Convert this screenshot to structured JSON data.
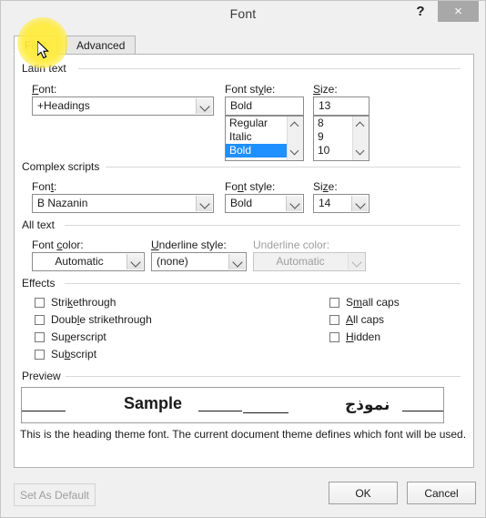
{
  "window": {
    "title": "Font",
    "help_label": "?",
    "close_label": "×"
  },
  "tabs": [
    {
      "label": "Font",
      "active": true
    },
    {
      "label": "Advanced",
      "active": false
    }
  ],
  "groups": {
    "latin_text": "Latin text",
    "complex_scripts": "Complex scripts",
    "all_text": "All text",
    "effects": "Effects",
    "preview": "Preview"
  },
  "latin_text": {
    "font_label": "Font:",
    "font_value": "+Headings",
    "style_label": "Font style:",
    "style_value": "Bold",
    "style_options": [
      "Regular",
      "Italic",
      "Bold"
    ],
    "style_selected": "Bold",
    "size_label": "Size:",
    "size_value": "13",
    "size_options": [
      "8",
      "9",
      "10"
    ],
    "size_selected": ""
  },
  "complex_scripts": {
    "font_label": "Font:",
    "font_value": "B Nazanin",
    "style_label": "Font style:",
    "style_value": "Bold",
    "size_label": "Size:",
    "size_value": "14"
  },
  "all_text": {
    "font_color_label": "Font color:",
    "font_color_value": "Automatic",
    "underline_style_label": "Underline style:",
    "underline_style_value": "(none)",
    "underline_color_label": "Underline color:",
    "underline_color_value": "Automatic",
    "underline_color_disabled": true
  },
  "effects": {
    "left": [
      {
        "label": "Strikethrough",
        "checked": false
      },
      {
        "label": "Double strikethrough",
        "checked": false
      },
      {
        "label": "Superscript",
        "checked": false
      },
      {
        "label": "Subscript",
        "checked": false
      }
    ],
    "right": [
      {
        "label": "Small caps",
        "checked": false
      },
      {
        "label": "All caps",
        "checked": false
      },
      {
        "label": "Hidden",
        "checked": false
      }
    ]
  },
  "preview": {
    "latin_sample": "Sample",
    "complex_sample": "نموذج",
    "note": "This is the heading theme font. The current document theme defines which font will be used."
  },
  "footer": {
    "set_as_default": "Set As Default",
    "set_as_default_disabled": true,
    "ok": "OK",
    "cancel": "Cancel"
  },
  "colors": {
    "dialog_bg": "#f0f0f0",
    "panel_bg": "#ffffff",
    "selection_blue": "#1e90ff",
    "highlight_yellow": "#ffeb3b",
    "disabled_text": "#9d9d9d"
  }
}
